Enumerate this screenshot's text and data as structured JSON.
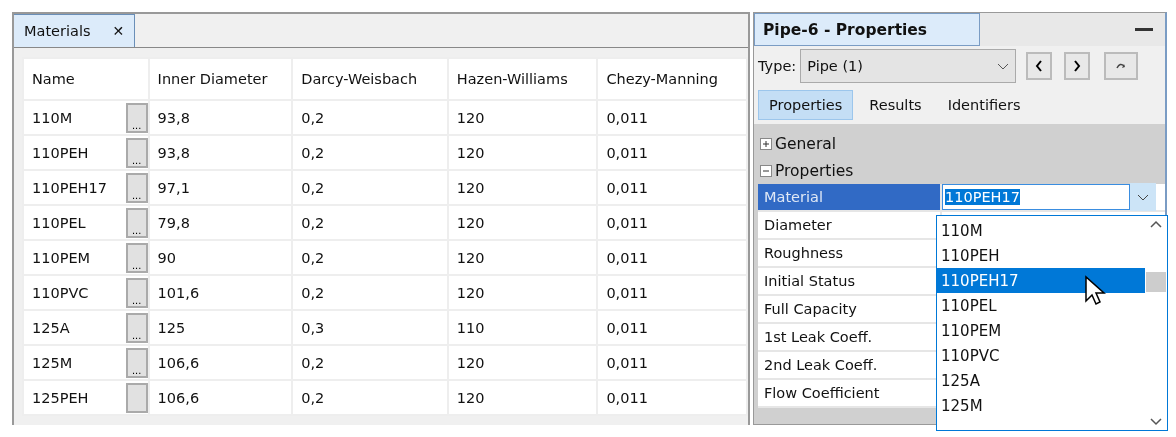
{
  "materials_panel": {
    "tab": {
      "label": "Materials",
      "close": "✕"
    },
    "table": {
      "columns": [
        "Name",
        "Inner Diameter",
        "Darcy-Weisbach",
        "Hazen-Williams",
        "Chezy-Manning"
      ],
      "rows": [
        {
          "name": "110M",
          "button": "...",
          "inner_diameter": "93,8",
          "darcy_weisbach": "0,2",
          "hazen_williams": "120",
          "chezy_manning": "0,011"
        },
        {
          "name": "110PEH",
          "button": "...",
          "inner_diameter": "93,8",
          "darcy_weisbach": "0,2",
          "hazen_williams": "120",
          "chezy_manning": "0,011"
        },
        {
          "name": "110PEH17",
          "button": "...",
          "inner_diameter": "97,1",
          "darcy_weisbach": "0,2",
          "hazen_williams": "120",
          "chezy_manning": "0,011"
        },
        {
          "name": "110PEL",
          "button": "...",
          "inner_diameter": "79,8",
          "darcy_weisbach": "0,2",
          "hazen_williams": "120",
          "chezy_manning": "0,011"
        },
        {
          "name": "110PEM",
          "button": "...",
          "inner_diameter": "90",
          "darcy_weisbach": "0,2",
          "hazen_williams": "120",
          "chezy_manning": "0,011"
        },
        {
          "name": "110PVC",
          "button": "...",
          "inner_diameter": "101,6",
          "darcy_weisbach": "0,2",
          "hazen_williams": "120",
          "chezy_manning": "0,011"
        },
        {
          "name": "125A",
          "button": "...",
          "inner_diameter": "125",
          "darcy_weisbach": "0,3",
          "hazen_williams": "110",
          "chezy_manning": "0,011"
        },
        {
          "name": "125M",
          "button": "...",
          "inner_diameter": "106,6",
          "darcy_weisbach": "0,2",
          "hazen_williams": "120",
          "chezy_manning": "0,011"
        },
        {
          "name": "125PEH",
          "inner_diameter": "106,6",
          "darcy_weisbach": "0,2",
          "hazen_williams": "120",
          "chezy_manning": "0,011"
        }
      ]
    }
  },
  "properties_panel": {
    "title": "Pipe-6 - Properties",
    "type_label": "Type:",
    "type_value": "Pipe (1)",
    "tabs": [
      {
        "label": "Properties",
        "selected": true
      },
      {
        "label": "Results",
        "selected": false
      },
      {
        "label": "Identifiers",
        "selected": false
      }
    ],
    "sections": [
      {
        "label": "General",
        "expanded": false
      },
      {
        "label": "Properties",
        "expanded": true
      }
    ],
    "rows": [
      {
        "name": "Material",
        "selected": true,
        "value": "110PEH17"
      },
      {
        "name": "Diameter",
        "selected": false
      },
      {
        "name": "Roughness",
        "selected": false
      },
      {
        "name": "Initial Status",
        "selected": false
      },
      {
        "name": "Full Capacity",
        "selected": false
      },
      {
        "name": "1st Leak Coeff.",
        "selected": false
      },
      {
        "name": "2nd Leak Coeff.",
        "selected": false
      },
      {
        "name": "Flow Coefficient",
        "selected": false
      }
    ],
    "dropdown": [
      {
        "label": "110M",
        "selected": false
      },
      {
        "label": "110PEH",
        "selected": false
      },
      {
        "label": "110PEH17",
        "selected": true
      },
      {
        "label": "110PEL",
        "selected": false
      },
      {
        "label": "110PEM",
        "selected": false
      },
      {
        "label": "110PVC",
        "selected": false
      },
      {
        "label": "125A",
        "selected": false
      },
      {
        "label": "125M",
        "selected": false
      }
    ]
  }
}
